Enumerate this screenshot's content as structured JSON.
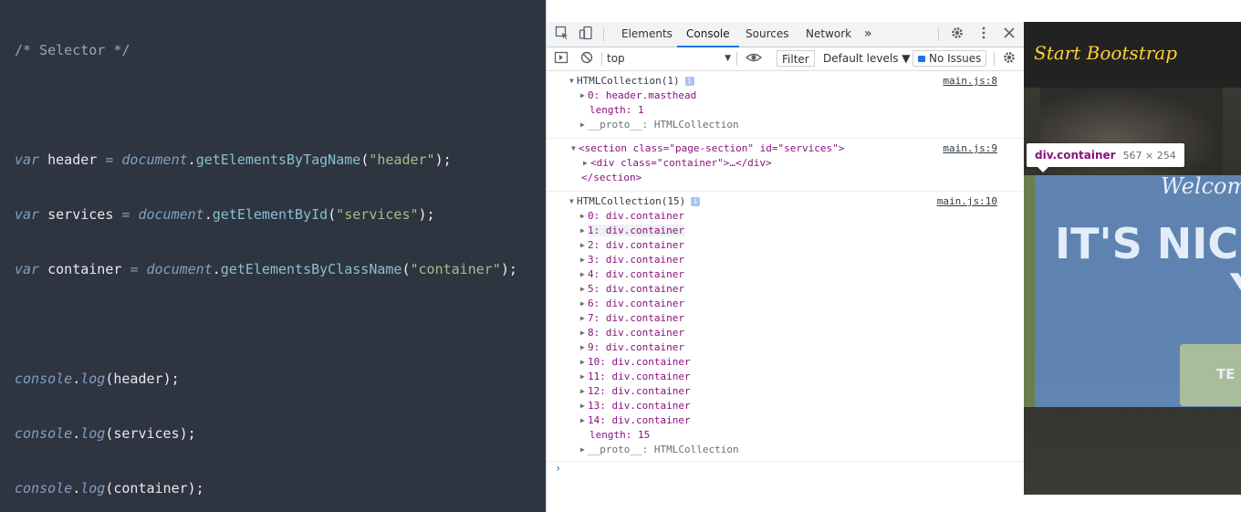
{
  "editor": {
    "comment": "/* Selector */",
    "lines": [
      {
        "kw": "var",
        "name": "header",
        "op": "=",
        "obj": "document",
        "fn": "getElementsByTagName",
        "arg": "\"header\""
      },
      {
        "kw": "var",
        "name": "services",
        "op": "=",
        "obj": "document",
        "fn": "getElementById",
        "arg": "\"services\""
      },
      {
        "kw": "var",
        "name": "container",
        "op": "=",
        "obj": "document",
        "fn": "getElementsByClassName",
        "arg": "\"container\""
      }
    ],
    "logs": [
      {
        "obj": "console",
        "fn": "log",
        "arg": "header"
      },
      {
        "obj": "console",
        "fn": "log",
        "arg": "services"
      },
      {
        "obj": "console",
        "fn": "log",
        "arg": "container"
      }
    ]
  },
  "devtools": {
    "tabs": [
      "Elements",
      "Console",
      "Sources",
      "Network"
    ],
    "active_tab": "Console",
    "more_tabs": "»",
    "context": "top",
    "filter_placeholder": "Filter",
    "levels": "Default levels ▼",
    "issues": "No Issues",
    "messages": {
      "m1": {
        "header": "HTMLCollection(1)",
        "src": "main.js:8",
        "item0": "0: header.masthead",
        "length": "length: 1",
        "proto": "__proto__: HTMLCollection"
      },
      "m2": {
        "open": "<section class=\"page-section\" id=\"services\">",
        "child": "<div class=\"container\">…</div>",
        "close": "</section>",
        "src": "main.js:9"
      },
      "m3": {
        "header": "HTMLCollection(15)",
        "src": "main.js:10",
        "items": [
          "0: div.container",
          "1: div.container",
          "2: div.container",
          "3: div.container",
          "4: div.container",
          "5: div.container",
          "6: div.container",
          "7: div.container",
          "8: div.container",
          "9: div.container",
          "10: div.container",
          "11: div.container",
          "12: div.container",
          "13: div.container",
          "14: div.container"
        ],
        "length": "length: 15",
        "proto": "__proto__: HTMLCollection"
      }
    },
    "prompt": "›"
  },
  "preview": {
    "brand": "Start Bootstrap",
    "welcome": "Welcome",
    "headline": "IT'S NIC",
    "headline2": "Y",
    "button": "TE",
    "tooltip_name": "div.container",
    "tooltip_size": "567 × 254"
  }
}
